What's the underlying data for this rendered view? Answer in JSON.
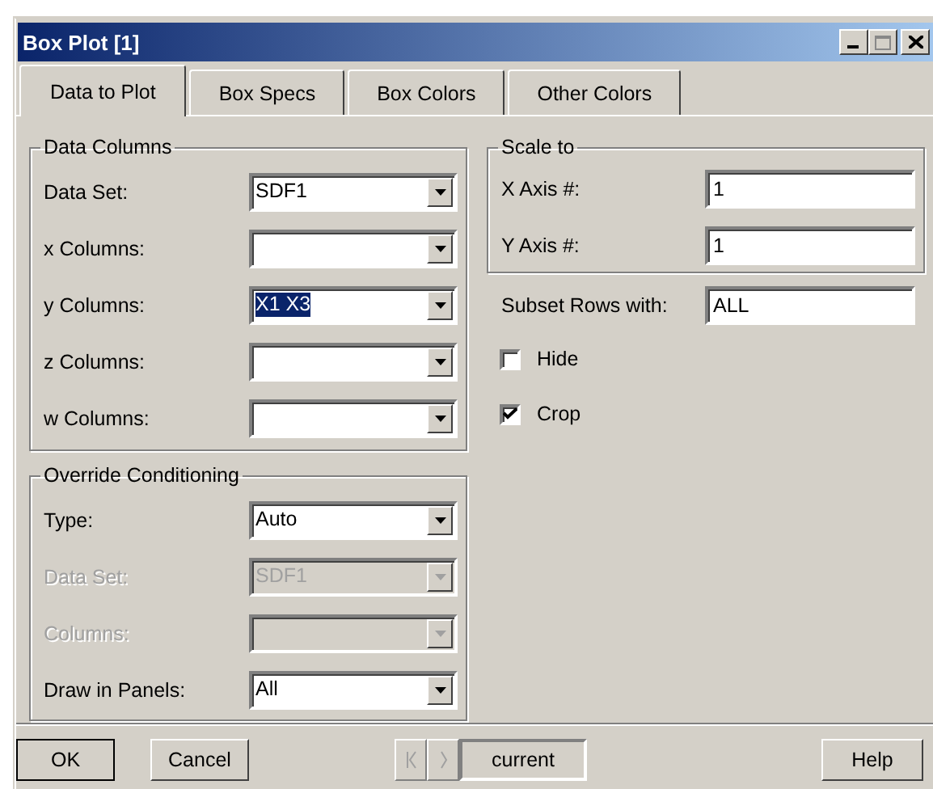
{
  "window": {
    "title": "Box Plot [1]"
  },
  "tabs": [
    {
      "label": "Data to Plot",
      "selected": true
    },
    {
      "label": "Box Specs",
      "selected": false
    },
    {
      "label": "Box Colors",
      "selected": false
    },
    {
      "label": "Other Colors",
      "selected": false
    }
  ],
  "data_columns": {
    "title": "Data Columns",
    "fields": [
      {
        "label": "Data Set:",
        "value": "SDF1",
        "highlighted": false,
        "disabled": false
      },
      {
        "label": "x Columns:",
        "highlighted": false,
        "disabled": false
      },
      {
        "label": "y Columns:",
        "value": "X1 X3",
        "highlighted": true,
        "disabled": false
      },
      {
        "label": "z Columns:",
        "highlighted": false,
        "disabled": false
      },
      {
        "label": "w Columns:",
        "highlighted": false,
        "disabled": false
      }
    ]
  },
  "override_conditioning": {
    "title": "Override Conditioning",
    "fields": [
      {
        "label": "Type:",
        "value": "Auto",
        "disabled": false
      },
      {
        "label": "Data Set:",
        "value": "SDF1",
        "disabled": true
      },
      {
        "label": "Columns:",
        "disabled": true
      },
      {
        "label": "Draw in Panels:",
        "value": "All",
        "disabled": false
      }
    ]
  },
  "scale_to": {
    "title": "Scale to",
    "fields": [
      {
        "label": "X Axis #:",
        "value": "1"
      },
      {
        "label": "Y Axis #:",
        "value": "1"
      }
    ]
  },
  "subset": {
    "label": "Subset Rows with:",
    "value": "ALL"
  },
  "checkboxes": [
    {
      "label": "Hide",
      "checked": false
    },
    {
      "label": "Crop",
      "checked": true
    }
  ],
  "footer": {
    "ok": "OK",
    "cancel": "Cancel",
    "current": "current",
    "help": "Help"
  }
}
